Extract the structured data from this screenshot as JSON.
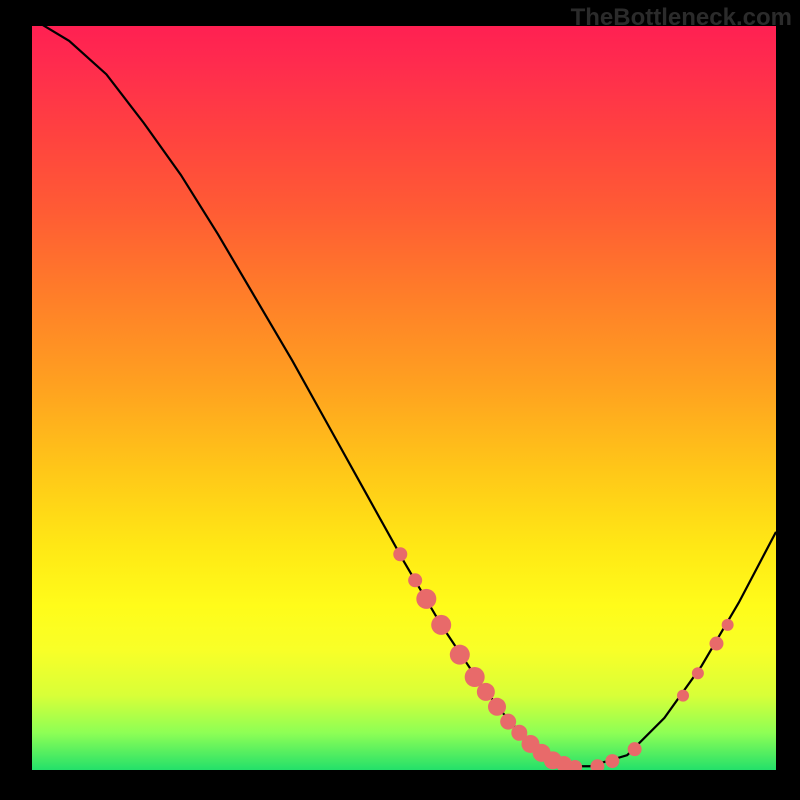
{
  "watermark": "TheBottleneck.com",
  "chart_data": {
    "type": "line",
    "xlim": [
      0,
      100
    ],
    "ylim": [
      0,
      100
    ],
    "curve_x": [
      0,
      5,
      10,
      15,
      20,
      25,
      30,
      35,
      40,
      45,
      50,
      55,
      60,
      63,
      66,
      69,
      72,
      75,
      80,
      85,
      90,
      95,
      100
    ],
    "curve_y": [
      101,
      98,
      93.5,
      87,
      80,
      72,
      63.5,
      55,
      46,
      37,
      28,
      19.5,
      12,
      8,
      4.5,
      2,
      0.5,
      0.5,
      2,
      7,
      14,
      22.5,
      32
    ],
    "markers": [
      {
        "x": 49.5,
        "y": 29,
        "r": 7
      },
      {
        "x": 51.5,
        "y": 25.5,
        "r": 7
      },
      {
        "x": 53,
        "y": 23,
        "r": 10
      },
      {
        "x": 55,
        "y": 19.5,
        "r": 10
      },
      {
        "x": 57.5,
        "y": 15.5,
        "r": 10
      },
      {
        "x": 59.5,
        "y": 12.5,
        "r": 10
      },
      {
        "x": 61,
        "y": 10.5,
        "r": 9
      },
      {
        "x": 62.5,
        "y": 8.5,
        "r": 9
      },
      {
        "x": 64,
        "y": 6.5,
        "r": 8
      },
      {
        "x": 65.5,
        "y": 5,
        "r": 8
      },
      {
        "x": 67,
        "y": 3.5,
        "r": 9
      },
      {
        "x": 68.5,
        "y": 2.3,
        "r": 9
      },
      {
        "x": 70,
        "y": 1.3,
        "r": 9
      },
      {
        "x": 71.5,
        "y": 0.8,
        "r": 8
      },
      {
        "x": 73,
        "y": 0.4,
        "r": 7
      },
      {
        "x": 76,
        "y": 0.5,
        "r": 7
      },
      {
        "x": 78,
        "y": 1.2,
        "r": 7
      },
      {
        "x": 81,
        "y": 2.8,
        "r": 7
      },
      {
        "x": 87.5,
        "y": 10,
        "r": 6
      },
      {
        "x": 89.5,
        "y": 13,
        "r": 6
      },
      {
        "x": 92,
        "y": 17,
        "r": 7
      },
      {
        "x": 93.5,
        "y": 19.5,
        "r": 6
      }
    ],
    "marker_color": "#e86a6a"
  }
}
